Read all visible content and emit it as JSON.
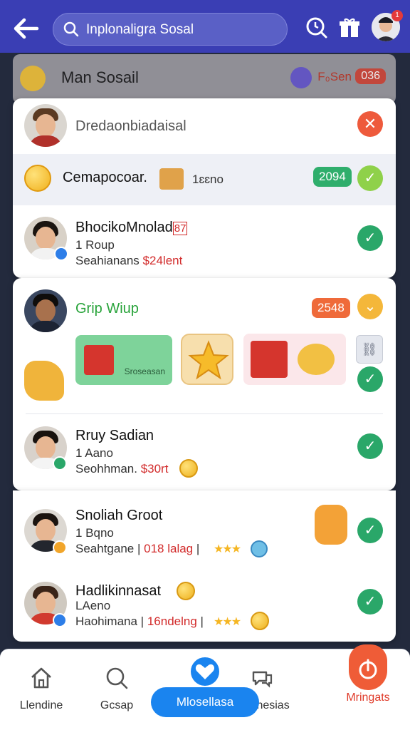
{
  "header": {
    "back_label": "←",
    "search_text": "Inplonaligra Sosal",
    "badge": "1"
  },
  "bg_card": {
    "title": "Man Sosail",
    "fee": "F₀Sen",
    "pill": "036"
  },
  "card1": {
    "first_row_text": "Dredaonbiadaisal",
    "strip_title": "Cemapocoar.",
    "strip_suffix": "1ɛɛno",
    "strip_pill": "2094",
    "row": {
      "name": "BhocikoMnolad",
      "name_tag": "87",
      "line2": "1 Roup",
      "line3_prefix": "Seahianans",
      "line3_red": "$24lent"
    }
  },
  "card2": {
    "group_title": "Grip Wiup",
    "group_pill": "2548",
    "sticker_label": "Sroseasan",
    "row": {
      "name": "Rruy Sadian",
      "line2": "1 Aano",
      "line3_prefix": "Seohhman.",
      "line3_red": "$30rt"
    }
  },
  "card3": {
    "rows": [
      {
        "name": "Snoliah Groot",
        "line2": "1 Bqno",
        "line3": "Seahtgane",
        "count": "018 lalag",
        "stars": "★★★"
      },
      {
        "name": "Hadlikinnasat",
        "line2": "LAeno",
        "line3": "Haohimana",
        "count": "16ndelng",
        "stars": "★★★"
      }
    ]
  },
  "nav": {
    "items": [
      "Llendine",
      "Gcsap",
      "Mlosellasa",
      "Ienenesias",
      "Mringats"
    ]
  },
  "colors": {
    "topbar": "#3a3eb4",
    "green": "#2aa769",
    "red": "#ee5a3c",
    "accent_blue": "#1a84ef"
  }
}
